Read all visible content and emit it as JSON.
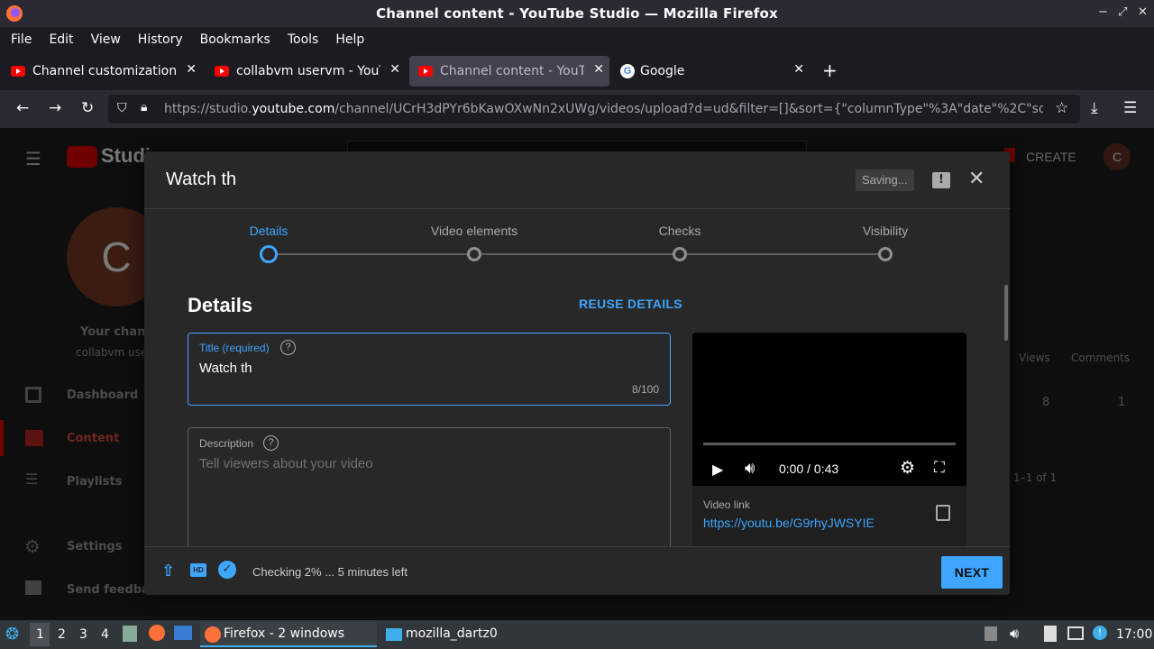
{
  "window": {
    "title": "Channel content - YouTube Studio — Mozilla Firefox",
    "controls": [
      "−",
      "✕",
      "✕"
    ]
  },
  "menu": [
    "File",
    "Edit",
    "View",
    "History",
    "Bookmarks",
    "Tools",
    "Help"
  ],
  "tabs": [
    {
      "label": "Channel customization -",
      "icon": "youtube-icon"
    },
    {
      "label": "collabvm uservm - YouTu",
      "icon": "youtube-icon"
    },
    {
      "label": "Channel content - YouTub",
      "icon": "youtube-icon",
      "active": true
    },
    {
      "label": "Google",
      "icon": "google-icon"
    }
  ],
  "url": {
    "prefix": "https://studio.",
    "domain": "youtube.com",
    "rest": "/channel/UCrH3dPYr6bKawOXwNn2xUWg/videos/upload?d=ud&filter=[]&sort={\"columnType\"%3A\"date\"%2C\"so"
  },
  "background": {
    "logo_text": "Studio",
    "create_label": "CREATE",
    "avatar_letter": "C",
    "channel_label": "Your chann",
    "channel_sub": "collabvm user",
    "nav": [
      "Dashboard",
      "Content",
      "Playlists",
      "Settings",
      "Send feedback"
    ],
    "col_views": "Views",
    "col_comments": "Comments",
    "row_views": "8",
    "row_comments": "1",
    "pagination": "1–1 of 1"
  },
  "dialog": {
    "title": "Watch th",
    "saving": "Saving...",
    "steps": [
      "Details",
      "Video elements",
      "Checks",
      "Visibility"
    ],
    "section_title": "Details",
    "reuse_label": "REUSE DETAILS",
    "title_field": {
      "label": "Title (required)",
      "value": "Watch th",
      "counter": "8/100"
    },
    "description_field": {
      "label": "Description",
      "placeholder": "Tell viewers about your video"
    },
    "video": {
      "time": "0:00 / 0:43",
      "link_label": "Video link",
      "link": "https://youtu.be/G9rhyJWSYIE"
    },
    "footer": {
      "status": "Checking 2% ... 5 minutes left",
      "next_label": "NEXT"
    }
  },
  "taskbar": {
    "desktops": [
      "1",
      "2",
      "3",
      "4"
    ],
    "firefox_label": "Firefox - 2 windows",
    "folder_label": "mozilla_dartz0",
    "clock": "17:00"
  }
}
